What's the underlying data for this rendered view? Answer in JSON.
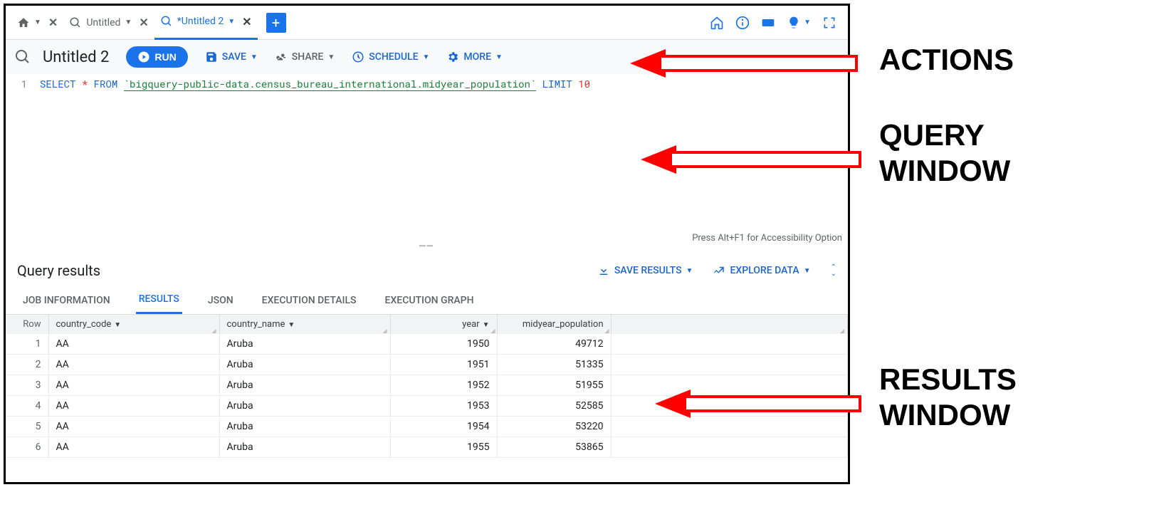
{
  "tabs": {
    "home_label": "",
    "untitled1": "Untitled",
    "untitled2": "*Untitled 2"
  },
  "actionbar": {
    "title": "Untitled 2",
    "run": "RUN",
    "save": "SAVE",
    "share": "SHARE",
    "schedule": "SCHEDULE",
    "more": "MORE"
  },
  "editor": {
    "line1_num": "1",
    "sql": {
      "select": "SELECT",
      "star": "*",
      "from": "FROM",
      "table": "`bigquery-public-data.census_bureau_international.midyear_population`",
      "limit": "LIMIT",
      "limit_val": "10"
    },
    "accessibility": "Press Alt+F1 for Accessibility Option"
  },
  "results": {
    "title": "Query results",
    "save_results": "SAVE RESULTS",
    "explore_data": "EXPLORE DATA",
    "tabs": {
      "job_info": "JOB INFORMATION",
      "results": "RESULTS",
      "json": "JSON",
      "exec_details": "EXECUTION DETAILS",
      "exec_graph": "EXECUTION GRAPH"
    },
    "columns": {
      "row": "Row",
      "country_code": "country_code",
      "country_name": "country_name",
      "year": "year",
      "midyear_population": "midyear_population"
    },
    "rows": [
      {
        "n": "1",
        "code": "AA",
        "name": "Aruba",
        "year": "1950",
        "pop": "49712"
      },
      {
        "n": "2",
        "code": "AA",
        "name": "Aruba",
        "year": "1951",
        "pop": "51335"
      },
      {
        "n": "3",
        "code": "AA",
        "name": "Aruba",
        "year": "1952",
        "pop": "51955"
      },
      {
        "n": "4",
        "code": "AA",
        "name": "Aruba",
        "year": "1953",
        "pop": "52585"
      },
      {
        "n": "5",
        "code": "AA",
        "name": "Aruba",
        "year": "1954",
        "pop": "53220"
      },
      {
        "n": "6",
        "code": "AA",
        "name": "Aruba",
        "year": "1955",
        "pop": "53865"
      }
    ]
  },
  "annotations": {
    "actions": "ACTIONS",
    "query_window": "QUERY\nWINDOW",
    "results_window": "RESULTS\nWINDOW"
  }
}
